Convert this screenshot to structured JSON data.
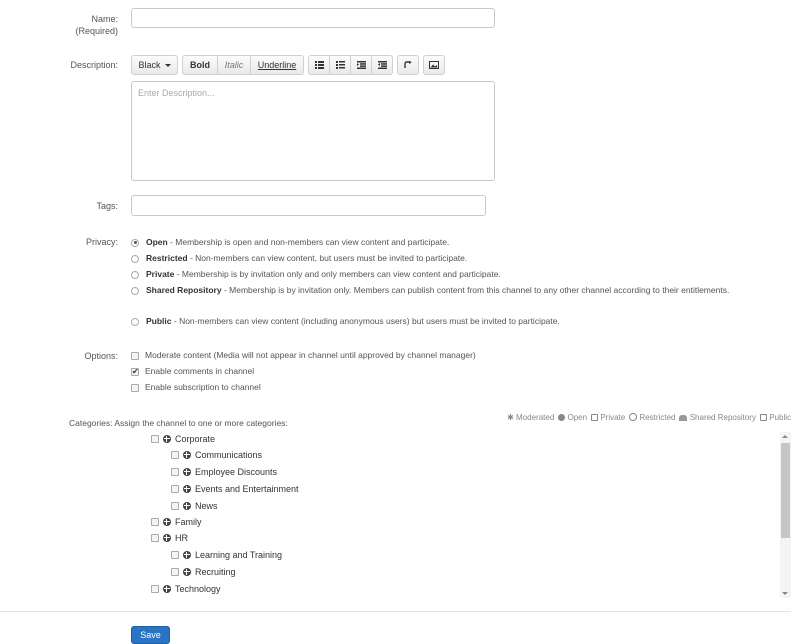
{
  "form": {
    "name_label": "Name:",
    "name_required": "(Required)",
    "name_value": "",
    "description_label": "Description:",
    "description_placeholder": "Enter Description...",
    "tags_label": "Tags:",
    "tags_value": "",
    "privacy_label": "Privacy:",
    "options_label": "Options:",
    "categories_label": "Categories:",
    "categories_hint": "Assign the channel to one or more categories:"
  },
  "toolbar": {
    "color_label": "Black",
    "bold_label": "Bold",
    "italic_label": "Italic",
    "underline_label": "Underline",
    "icons": [
      "unordered-list-icon",
      "ordered-list-icon",
      "outdent-icon",
      "indent-icon",
      "link-icon",
      "image-icon"
    ]
  },
  "privacy": {
    "selected": "Open",
    "options": [
      {
        "name": "Open",
        "desc": " - Membership is open and non-members can view content and participate."
      },
      {
        "name": "Restricted",
        "desc": " - Non-members can view content, but users must be invited to participate."
      },
      {
        "name": "Private",
        "desc": " - Membership is by invitation only and only members can view content and participate."
      },
      {
        "name": "Shared Repository",
        "desc": " - Membership is by invitation only. Members can publish content from this channel to any other channel according to their entitlements."
      },
      {
        "name": "Public",
        "desc": " - Non-members can view content (including anonymous users) but users must be invited to participate."
      }
    ]
  },
  "options": [
    {
      "label": "Moderate content (Media will not appear in channel until approved by channel manager)",
      "checked": false
    },
    {
      "label": "Enable comments in channel",
      "checked": true
    },
    {
      "label": "Enable subscription to channel",
      "checked": false
    }
  ],
  "legend": {
    "moderated": "Moderated",
    "open": "Open",
    "private": "Private",
    "restricted": "Restricted",
    "shared": "Shared Repository",
    "public": "Public"
  },
  "categories": [
    {
      "label": "Corporate",
      "level": 0
    },
    {
      "label": "Communications",
      "level": 1
    },
    {
      "label": "Employee Discounts",
      "level": 1
    },
    {
      "label": "Events and Entertainment",
      "level": 1
    },
    {
      "label": "News",
      "level": 1
    },
    {
      "label": "Family",
      "level": 0
    },
    {
      "label": "HR",
      "level": 0
    },
    {
      "label": "Learning and Training",
      "level": 1
    },
    {
      "label": "Recruiting",
      "level": 1
    },
    {
      "label": "Technology",
      "level": 0
    }
  ],
  "save_label": "Save"
}
